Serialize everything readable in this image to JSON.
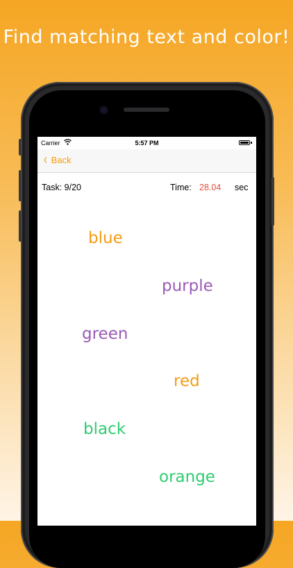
{
  "headline": "Find matching text and color!",
  "status_bar": {
    "carrier": "Carrier",
    "time": "5:57 PM"
  },
  "nav": {
    "back_label": "Back"
  },
  "game": {
    "task": "Task: 9/20",
    "time_label": "Time:",
    "time_value": "28.04",
    "time_unit": "sec"
  },
  "words": [
    {
      "text": "blue",
      "color": "#f39c12"
    },
    {
      "text": "purple",
      "color": "#9b59b6"
    },
    {
      "text": "green",
      "color": "#9b59b6"
    },
    {
      "text": "red",
      "color": "#f39c12"
    },
    {
      "text": "black",
      "color": "#2ecc71"
    },
    {
      "text": "orange",
      "color": "#2ecc71"
    }
  ],
  "colors": {
    "accent": "#f39c12",
    "timer": "#e74c3c"
  }
}
